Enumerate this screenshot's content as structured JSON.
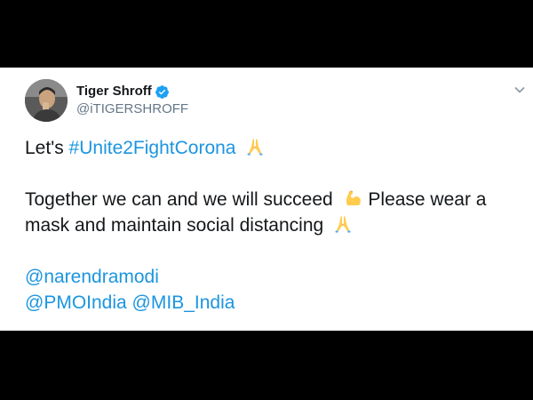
{
  "tweet": {
    "author": {
      "display_name": "Tiger Shroff",
      "handle": "@iTIGERSHROFF",
      "verified": true
    },
    "lines": {
      "l1_prefix": "Let's",
      "l1_hashtag": "#Unite2FightCorona",
      "l2_text": "Together we can and we will succeed",
      "l2_suffix": "Please wear a",
      "l3_text": "mask and maintain social distancing",
      "mention_1": "@narendramodi",
      "mention_2": "@PMOIndia",
      "mention_3": "@MIB_India"
    },
    "emojis": [
      "folded-hands",
      "flexed-biceps",
      "folded-hands"
    ]
  },
  "colors": {
    "link": "#1b95e0",
    "text": "#14171a",
    "secondary": "#657786",
    "verified_badge": "#1da1f2",
    "letterbox": "#000000"
  },
  "icons": [
    "verified-badge-icon",
    "chevron-down-icon",
    "folded-hands-emoji",
    "flexed-biceps-emoji"
  ]
}
